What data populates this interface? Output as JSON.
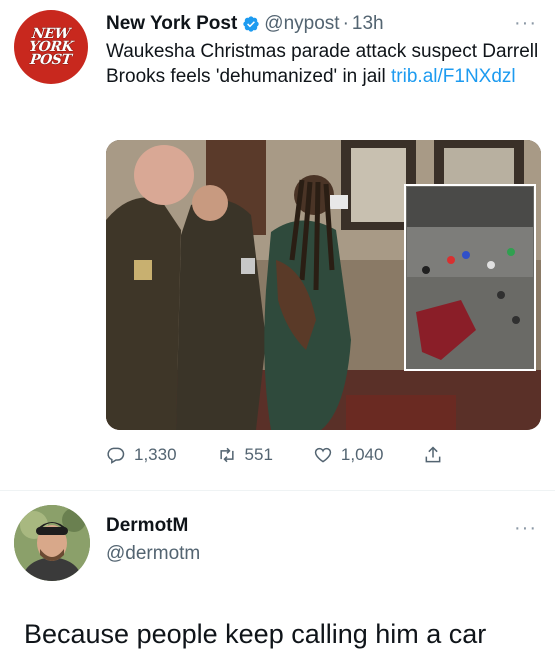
{
  "tweet": {
    "avatar_text": [
      "NEW",
      "YORK",
      "POST"
    ],
    "name": "New York Post",
    "handle": "@nypost",
    "separator": "·",
    "time": "13h",
    "more": "···",
    "text": "Waukesha Christmas parade attack suspect Darrell Brooks feels 'dehumanized' in jail",
    "link": "trib.al/F1NXdzl",
    "replies": "1,330",
    "retweets": "551",
    "likes": "1,040"
  },
  "reply": {
    "name": "DermotM",
    "handle": "@dermotm",
    "more": "···",
    "text": "Because people keep calling him a car"
  },
  "colors": {
    "nyp_red": "#c8281e",
    "verified_blue": "#1d9bf0",
    "link_blue": "#1d9bf0",
    "secondary_text": "#536471"
  },
  "icons": [
    "verified-badge-icon",
    "reply-icon",
    "retweet-icon",
    "like-icon",
    "share-icon",
    "more-icon"
  ]
}
